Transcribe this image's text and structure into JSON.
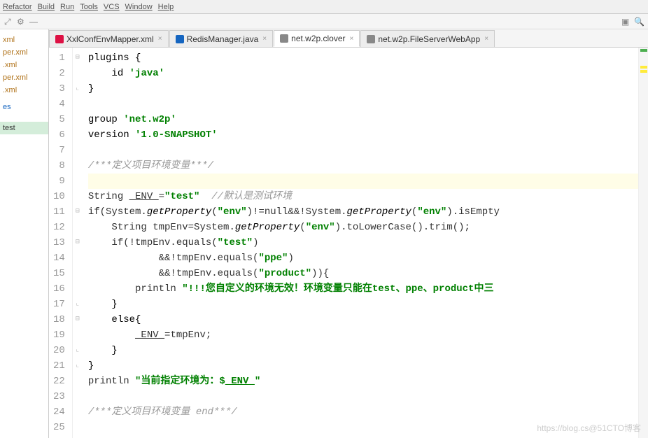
{
  "menu": [
    "Refactor",
    "Build",
    "Run",
    "Tools",
    "VCS",
    "Window",
    "Help"
  ],
  "sidebar": {
    "items": [
      {
        "label": "xml",
        "cls": ""
      },
      {
        "label": "per.xml",
        "cls": ""
      },
      {
        "label": ".xml",
        "cls": ""
      },
      {
        "label": "per.xml",
        "cls": ""
      },
      {
        "label": ".xml",
        "cls": ""
      },
      {
        "label": "",
        "cls": ""
      },
      {
        "label": "es",
        "cls": "blue"
      },
      {
        "label": "",
        "cls": ""
      },
      {
        "label": "",
        "cls": ""
      },
      {
        "label": "test",
        "cls": "sel"
      }
    ]
  },
  "tabs": [
    {
      "label": "XxlConfEnvMapper.xml",
      "icon": "#d14",
      "active": false
    },
    {
      "label": "RedisManager.java",
      "icon": "#1565c0",
      "active": false
    },
    {
      "label": "net.w2p.clover",
      "icon": "#888",
      "active": true
    },
    {
      "label": "net.w2p.FileServerWebApp",
      "icon": "#888",
      "active": false
    }
  ],
  "code": {
    "lines": [
      {
        "n": 1,
        "t": "plain",
        "indent": 0,
        "text": "plugins {"
      },
      {
        "n": 2,
        "t": "plain",
        "indent": 1,
        "pre": "id ",
        "str": "'java'"
      },
      {
        "n": 3,
        "t": "plain",
        "indent": 0,
        "text": "}"
      },
      {
        "n": 4,
        "t": "empty"
      },
      {
        "n": 5,
        "t": "plain",
        "indent": 0,
        "pre": "group ",
        "str": "'net.w2p'"
      },
      {
        "n": 6,
        "t": "plain",
        "indent": 0,
        "pre": "version ",
        "str": "'1.0-SNAPSHOT'"
      },
      {
        "n": 7,
        "t": "empty"
      },
      {
        "n": 8,
        "t": "cmt",
        "indent": 0,
        "text": "/***定义项目环境变量***/"
      },
      {
        "n": 9,
        "t": "empty",
        "hl": true
      },
      {
        "n": 10,
        "t": "raw",
        "indent": 0,
        "html": "String <span class='hl-var'>_ENV_</span>=<span class='str'>\"test\"</span>  <span class='cmt'>//默认是测试环境</span>"
      },
      {
        "n": 11,
        "t": "raw",
        "indent": 0,
        "html": "if(System.<span class='fn'>getProperty</span>(<span class='str'>\"env\"</span>)!=null&&!System.<span class='fn'>getProperty</span>(<span class='str'>\"env\"</span>).isEmpty"
      },
      {
        "n": 12,
        "t": "raw",
        "indent": 1,
        "html": "String tmpEnv=System.<span class='fn'>getProperty</span>(<span class='str'>\"env\"</span>).toLowerCase().trim();"
      },
      {
        "n": 13,
        "t": "raw",
        "indent": 1,
        "html": "if(!tmpEnv.equals(<span class='str'>\"test\"</span>)"
      },
      {
        "n": 14,
        "t": "raw",
        "indent": 3,
        "html": "&&!tmpEnv.equals(<span class='str'>\"ppe\"</span>)"
      },
      {
        "n": 15,
        "t": "raw",
        "indent": 3,
        "html": "&&!tmpEnv.equals(<span class='str'>\"product\"</span>)){"
      },
      {
        "n": 16,
        "t": "raw",
        "indent": 2,
        "html": "println <span class='str'>\"!!!您自定义的环境无效！环境变量只能在test、ppe、product中三</span>"
      },
      {
        "n": 17,
        "t": "plain",
        "indent": 1,
        "text": "}"
      },
      {
        "n": 18,
        "t": "plain",
        "indent": 1,
        "text": "else{"
      },
      {
        "n": 19,
        "t": "raw",
        "indent": 2,
        "html": "<span class='hl-var'>_ENV_</span>=tmpEnv;"
      },
      {
        "n": 20,
        "t": "plain",
        "indent": 1,
        "text": "}"
      },
      {
        "n": 21,
        "t": "plain",
        "indent": 0,
        "text": "}"
      },
      {
        "n": 22,
        "t": "raw",
        "indent": 0,
        "html": "println <span class='str'>\"当前指定环境为：$<span class='hl-var'>_ENV_</span>\"</span>"
      },
      {
        "n": 23,
        "t": "empty"
      },
      {
        "n": 24,
        "t": "cmt",
        "indent": 0,
        "text": "/***定义项目环境变量 end***/"
      },
      {
        "n": 25,
        "t": "empty"
      }
    ]
  },
  "watermark": "https://blog.cs@51CTO博客"
}
